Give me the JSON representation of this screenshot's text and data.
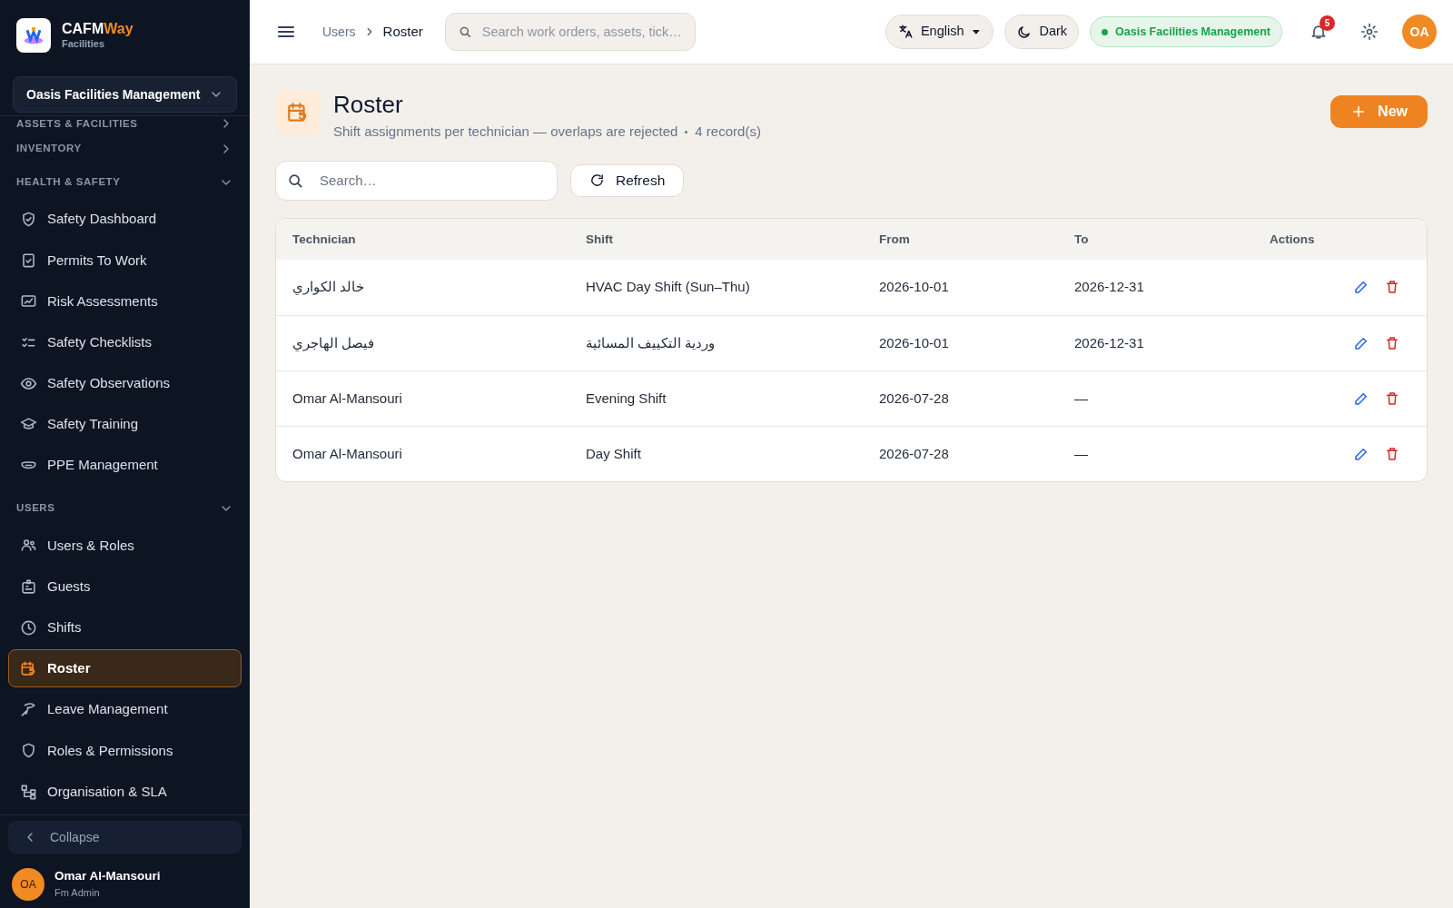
{
  "sidebar": {
    "brand": {
      "name": "CAFM",
      "accent": "Way",
      "subtitle": "Facilities"
    },
    "org_selector": "Oasis Facilities Management",
    "sections": [
      {
        "label": "ASSETS & FACILITIES",
        "expanded": false
      },
      {
        "label": "INVENTORY",
        "expanded": false
      },
      {
        "label": "HEALTH & SAFETY",
        "expanded": true,
        "children": [
          {
            "label": "Safety Dashboard",
            "selected": false
          },
          {
            "label": "Permits To Work",
            "selected": false
          },
          {
            "label": "Risk Assessments",
            "selected": false
          },
          {
            "label": "Safety Checklists",
            "selected": false
          },
          {
            "label": "Safety Observations",
            "selected": false
          },
          {
            "label": "Safety Training",
            "selected": false
          },
          {
            "label": "PPE Management",
            "selected": false
          }
        ]
      },
      {
        "label": "USERS",
        "expanded": true,
        "children": [
          {
            "label": "Users & Roles",
            "selected": false
          },
          {
            "label": "Guests",
            "selected": false
          },
          {
            "label": "Shifts",
            "selected": false
          },
          {
            "label": "Roster",
            "selected": true
          },
          {
            "label": "Leave Management",
            "selected": false
          },
          {
            "label": "Roles & Permissions",
            "selected": false
          },
          {
            "label": "Organisation & SLA",
            "selected": false
          }
        ]
      }
    ],
    "collapse": "Collapse",
    "user": {
      "initials": "OA",
      "name": "Omar Al-Mansouri",
      "role": "Fm Admin"
    }
  },
  "topbar": {
    "breadcrumbs": [
      "Users",
      "Roster"
    ],
    "search": {
      "placeholder": "Search work orders, assets, tick…"
    },
    "language": "English",
    "theme": "Dark",
    "organisation": "Oasis Facilities Management",
    "notifications": "5",
    "avatar": "OA"
  },
  "page": {
    "title": "Roster",
    "subtitle": "Shift assignments per technician — overlaps are rejected",
    "count": "4 record(s)",
    "new_button": "New",
    "search": {
      "placeholder": "Search…"
    },
    "refresh_button": "Refresh"
  },
  "table": {
    "columns": [
      "Technician",
      "Shift",
      "From",
      "To",
      "Actions"
    ],
    "rows": [
      {
        "technician": "خالد الكواري",
        "shift": "HVAC Day Shift (Sun–Thu)",
        "from": "2026-10-01",
        "to": "2026-12-31"
      },
      {
        "technician": "فيصل الهاجري",
        "shift": "وردية التكييف المسائية",
        "from": "2026-10-01",
        "to": "2026-12-31"
      },
      {
        "technician": "Omar Al-Mansouri",
        "shift": "Evening Shift",
        "from": "2026-07-28",
        "to": "—"
      },
      {
        "technician": "Omar Al-Mansouri",
        "shift": "Day Shift",
        "from": "2026-07-28",
        "to": "—"
      }
    ]
  }
}
